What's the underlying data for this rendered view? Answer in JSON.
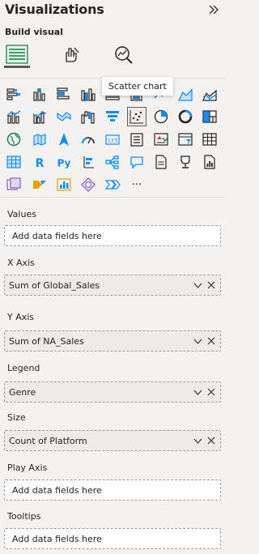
{
  "header": {
    "title": "Visualizations",
    "collapse_icon": "double-chevron-right-icon"
  },
  "build": {
    "label": "Build visual",
    "tabs": [
      {
        "icon": "build-visual-fields-icon",
        "active": true
      },
      {
        "icon": "format-visual-icon",
        "active": false
      },
      {
        "icon": "analytics-magnifier-icon",
        "active": false
      }
    ]
  },
  "tooltip": "Scatter chart",
  "more_label": "···",
  "wells": {
    "values": {
      "label": "Values",
      "placeholder": "Add data fields here"
    },
    "x_axis": {
      "label": "X Axis",
      "field": "Sum of Global_Sales"
    },
    "y_axis": {
      "label": "Y Axis",
      "field": "Sum of NA_Sales"
    },
    "legend": {
      "label": "Legend",
      "field": "Genre"
    },
    "size": {
      "label": "Size",
      "field": "Count of Platform"
    },
    "play_axis": {
      "label": "Play Axis",
      "placeholder": "Add data fields here"
    },
    "tooltips": {
      "label": "Tooltips",
      "placeholder": "Add data fields here"
    }
  },
  "text": {
    "r_label": "R",
    "py_label": "Py",
    "card_label": "123"
  }
}
